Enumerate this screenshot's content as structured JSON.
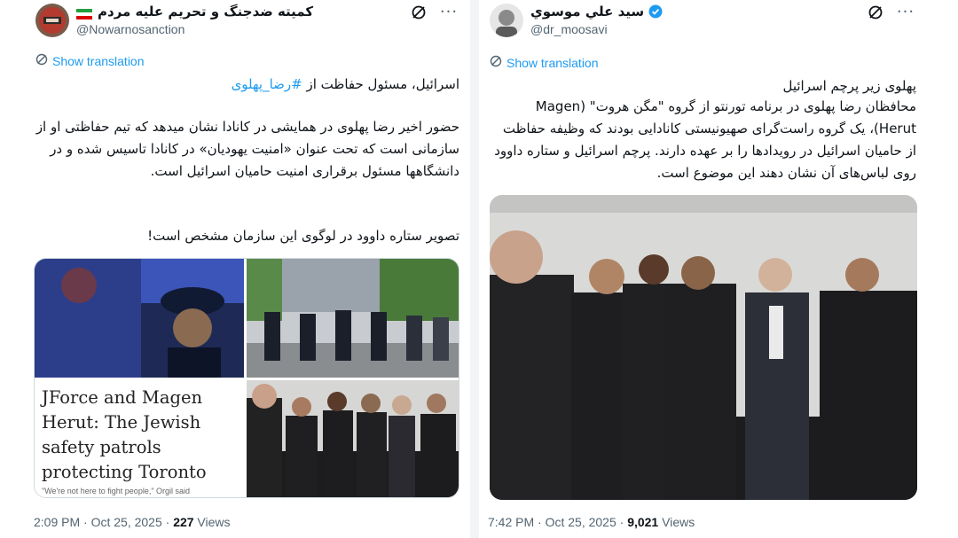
{
  "left_tweet": {
    "display_name": "کمیته ضدجنگ و تحریم علیه مردم",
    "handle": "@Nowarnosanction",
    "show_translation": "Show translation",
    "title_prefix": "اسرائیل، مسئول حفاظت از ",
    "title_hashtag": "#رضا_پهلوی",
    "paragraph": "حضور اخیر رضا پهلوی در همایشی در کانادا نشان میدهد که تیم حفاظتی او از سازمانی است که تحت عنوان «امنیت یهودیان» در کانادا تاسیس شده و در دانشگاهها مسئول برقراری امنیت حامیان اسرائیل است.",
    "paragraph2": "تصویر ستاره داوود در لوگوی این سازمان مشخص است!",
    "article_headline": "JForce and Magen Herut: The Jewish safety patrols protecting Toronto",
    "article_snippet": "\"We're not here to fight people,\" Orgil said",
    "time": "2:09 PM · Oct 25, 2025 · ",
    "views_count": "227",
    "views_label": " Views"
  },
  "right_tweet": {
    "display_name": "سيد علي موسوي",
    "handle": "@dr_moosavi",
    "show_translation": "Show translation",
    "title": "پهلوی زیر پرچم اسرائیل",
    "paragraph": "محافظان رضا پهلوی در برنامه تورنتو از گروه \"مگن هروت\" (Magen Herut)، یک گروه راست‌گرای صهیونیستی کانادایی بودند که وظیفه حفاظت از حامیان اسرائیل در رویدادها را بر عهده دارند. پرچم اسرائیل و ستاره داوود روی لباس‌های آن نشان دهند این موضوع است.",
    "time": "7:42 PM · Oct 25, 2025 · ",
    "views_count": "9,021",
    "views_label": " Views"
  },
  "colors": {
    "link": "#1d9bf0",
    "muted": "#536471",
    "verified": "#1d9bf0"
  },
  "icons": [
    "grok-slash-icon",
    "more-icon",
    "translate-icon",
    "verified-badge-icon",
    "iran-flag-icon"
  ]
}
